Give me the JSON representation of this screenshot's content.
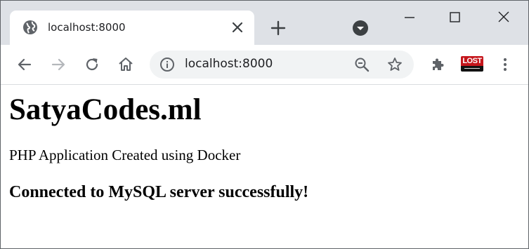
{
  "tab": {
    "title": "localhost:8000",
    "favicon": "globe-icon"
  },
  "toolbar": {
    "back": "back-arrow-icon",
    "forward": "forward-arrow-icon",
    "reload": "reload-icon",
    "home": "home-icon",
    "url": "localhost:8000",
    "extensions": "puzzle-icon",
    "menu": "more-vertical-icon"
  },
  "extension": {
    "label": "LOST"
  },
  "page": {
    "heading": "SatyaCodes.ml",
    "paragraph": "PHP Application Created using Docker",
    "status": "Connected to MySQL server successfully!"
  },
  "colors": {
    "tabstrip_bg": "#dee1e6",
    "omnibox_bg": "#f1f3f4",
    "icon_gray": "#5f6368",
    "extension_red": "#c5161c"
  }
}
